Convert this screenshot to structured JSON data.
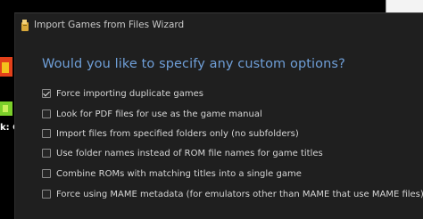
{
  "window": {
    "title": "Import Games from Files Wizard",
    "heading": "Would you like to specify any custom options?"
  },
  "options": [
    {
      "label": "Force importing duplicate games",
      "checked": true
    },
    {
      "label": "Look for PDF files for use as the game manual",
      "checked": false
    },
    {
      "label": "Import files from specified folders only (no subfolders)",
      "checked": false
    },
    {
      "label": "Use folder names instead of ROM file names for game titles",
      "checked": false
    },
    {
      "label": "Combine ROMs with matching titles into a single game",
      "checked": false
    },
    {
      "label": "Force using MAME metadata (for emulators other than MAME that use MAME files)",
      "checked": false
    }
  ],
  "background_app": {
    "partial_text": "k: G"
  },
  "colors": {
    "window_bg": "#1f1f1f",
    "heading": "#6f9fd8",
    "text": "#d6d6d6"
  }
}
